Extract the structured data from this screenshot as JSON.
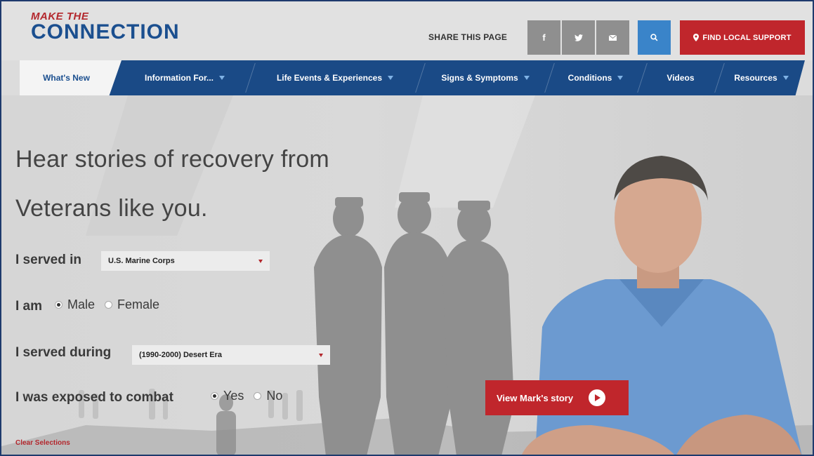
{
  "logo": {
    "top": "MAKE THE",
    "main": "CONNECTION"
  },
  "share": {
    "label": "SHARE THIS PAGE",
    "facebook": "f",
    "twitter": "❅",
    "email": "✉"
  },
  "find_support": "FIND LOCAL SUPPORT",
  "nav": [
    {
      "label": "What's New",
      "caret": false
    },
    {
      "label": "Information For...",
      "caret": true
    },
    {
      "label": "Life Events & Experiences",
      "caret": true
    },
    {
      "label": "Signs & Symptoms",
      "caret": true
    },
    {
      "label": "Conditions",
      "caret": true
    },
    {
      "label": "Videos",
      "caret": false
    },
    {
      "label": "Resources",
      "caret": true
    }
  ],
  "hero": {
    "headline_1": "Hear stories of recovery from",
    "headline_2": "Veterans like you.",
    "served_in_label": "I served in",
    "served_in_value": "U.S. Marine Corps",
    "i_am_label": "I am",
    "male": "Male",
    "female": "Female",
    "served_during_label": "I served during",
    "served_during_value": "(1990-2000) Desert Era",
    "combat_label": "I was exposed to combat",
    "yes": "Yes",
    "no": "No",
    "clear": "Clear Selections",
    "story_button": "View Mark's story"
  },
  "colors": {
    "brand_blue": "#1a4a86",
    "brand_red": "#c0262c",
    "search_blue": "#3a84c9"
  }
}
